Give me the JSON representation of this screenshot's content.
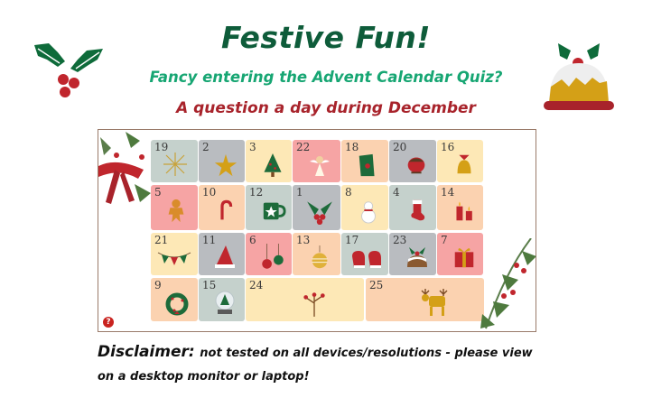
{
  "header": {
    "title": "Festive Fun!",
    "subtitle": "Fancy entering the Advent Calendar Quiz?",
    "tagline": "A question a day during December"
  },
  "colors": {
    "title": "#0e5c3a",
    "subtitle": "#17a673",
    "tagline": "#a8232b",
    "tile_grey": "#b9bcc0",
    "tile_sage": "#c5d1cc",
    "tile_cream": "#fde8b6",
    "tile_peach": "#fbd2b0",
    "tile_pink": "#f6a4a4"
  },
  "calendar": {
    "doors": [
      {
        "day": "19",
        "icon": "firework-icon"
      },
      {
        "day": "2",
        "icon": "star-icon"
      },
      {
        "day": "3",
        "icon": "christmas-tree-icon"
      },
      {
        "day": "22",
        "icon": "angel-icon"
      },
      {
        "day": "18",
        "icon": "christmas-card-icon"
      },
      {
        "day": "20",
        "icon": "robin-icon"
      },
      {
        "day": "16",
        "icon": "bells-icon"
      },
      {
        "day": "5",
        "icon": "gingerbread-man-icon"
      },
      {
        "day": "10",
        "icon": "candy-cane-icon"
      },
      {
        "day": "12",
        "icon": "mug-icon"
      },
      {
        "day": "1",
        "icon": "holly-icon"
      },
      {
        "day": "8",
        "icon": "snowman-icon"
      },
      {
        "day": "4",
        "icon": "stocking-icon"
      },
      {
        "day": "14",
        "icon": "candles-icon"
      },
      {
        "day": "21",
        "icon": "bunting-icon"
      },
      {
        "day": "11",
        "icon": "santa-hat-icon"
      },
      {
        "day": "6",
        "icon": "baubles-icon"
      },
      {
        "day": "13",
        "icon": "bauble-icon"
      },
      {
        "day": "17",
        "icon": "mittens-icon"
      },
      {
        "day": "23",
        "icon": "pudding-icon"
      },
      {
        "day": "7",
        "icon": "present-icon"
      },
      {
        "day": "9",
        "icon": "wreath-icon"
      },
      {
        "day": "15",
        "icon": "snow-globe-icon"
      },
      {
        "day": "24",
        "icon": "berry-sprig-icon"
      },
      {
        "day": "25",
        "icon": "reindeer-icon"
      }
    ],
    "help_label": "?"
  },
  "disclaimer": {
    "label": "Disclaimer:",
    "text": "not tested on all devices/resolutions - please view on a desktop monitor or laptop!"
  }
}
